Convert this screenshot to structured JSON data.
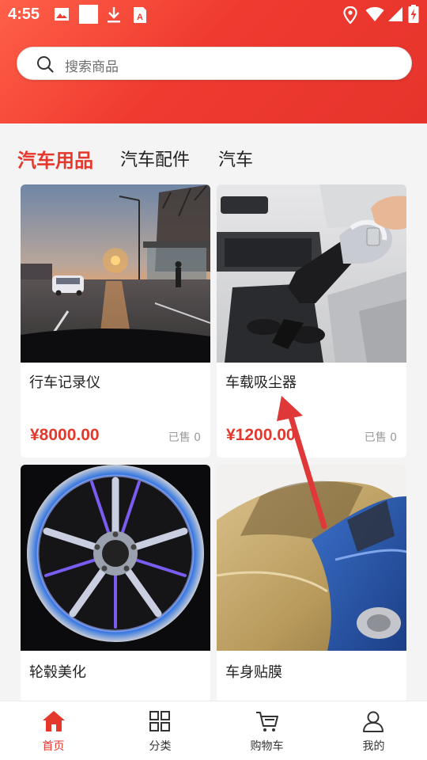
{
  "status_bar": {
    "time": "4:55"
  },
  "search": {
    "placeholder": "搜索商品"
  },
  "tabs": [
    {
      "label": "汽车用品",
      "active": true
    },
    {
      "label": "汽车配件",
      "active": false
    },
    {
      "label": "汽车",
      "active": false
    }
  ],
  "products": [
    {
      "title": "行车记录仪",
      "price": "¥8000.00",
      "sold": "已售 0",
      "image": "dashcam-sunset-road"
    },
    {
      "title": "车载吸尘器",
      "price": "¥1200.00",
      "sold": "已售 0",
      "image": "car-vacuum-cleaner"
    },
    {
      "title": "轮毂美化",
      "price": "",
      "sold": "",
      "image": "chrome-purple-wheel"
    },
    {
      "title": "车身贴膜",
      "price": "",
      "sold": "",
      "image": "gold-blue-wrapped-car"
    }
  ],
  "bottom_nav": [
    {
      "label": "首页",
      "icon": "home-icon",
      "active": true
    },
    {
      "label": "分类",
      "icon": "grid-icon",
      "active": false
    },
    {
      "label": "购物车",
      "icon": "cart-icon",
      "active": false
    },
    {
      "label": "我的",
      "icon": "user-icon",
      "active": false
    }
  ],
  "colors": {
    "brand": "#e5382c",
    "header_start": "#ff6048",
    "header_end": "#e6342c"
  }
}
